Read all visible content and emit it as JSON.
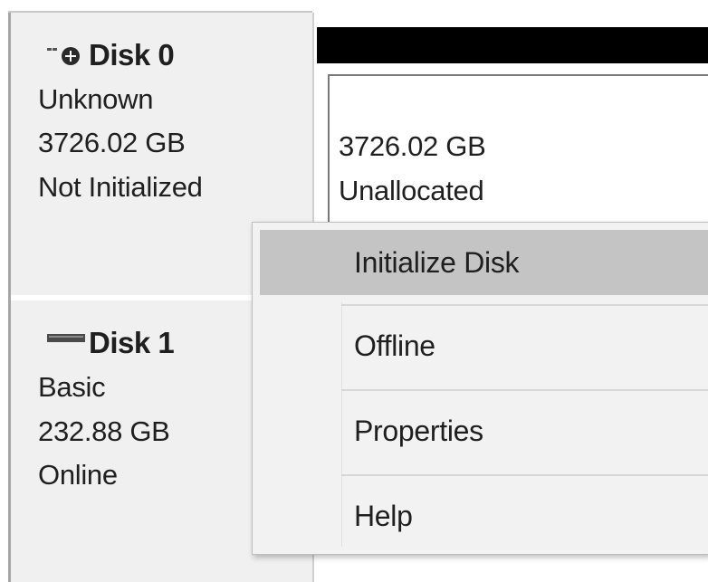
{
  "disks": [
    {
      "name": "Disk 0",
      "type": "Unknown",
      "size": "3726.02 GB",
      "status": "Not Initialized",
      "icon": "disk-not-initialized-icon",
      "volume": {
        "size": "3726.02 GB",
        "status": "Unallocated",
        "header_color": "#000000"
      }
    },
    {
      "name": "Disk 1",
      "type": "Basic",
      "size": "232.88 GB",
      "status": "Online",
      "icon": "disk-icon"
    }
  ],
  "context_menu": {
    "items": [
      {
        "label": "Initialize Disk",
        "highlighted": true
      },
      {
        "label": "Offline",
        "highlighted": false
      },
      {
        "label": "Properties",
        "highlighted": false
      },
      {
        "label": "Help",
        "highlighted": false
      }
    ],
    "highlight_color": "#c4c4c4"
  }
}
